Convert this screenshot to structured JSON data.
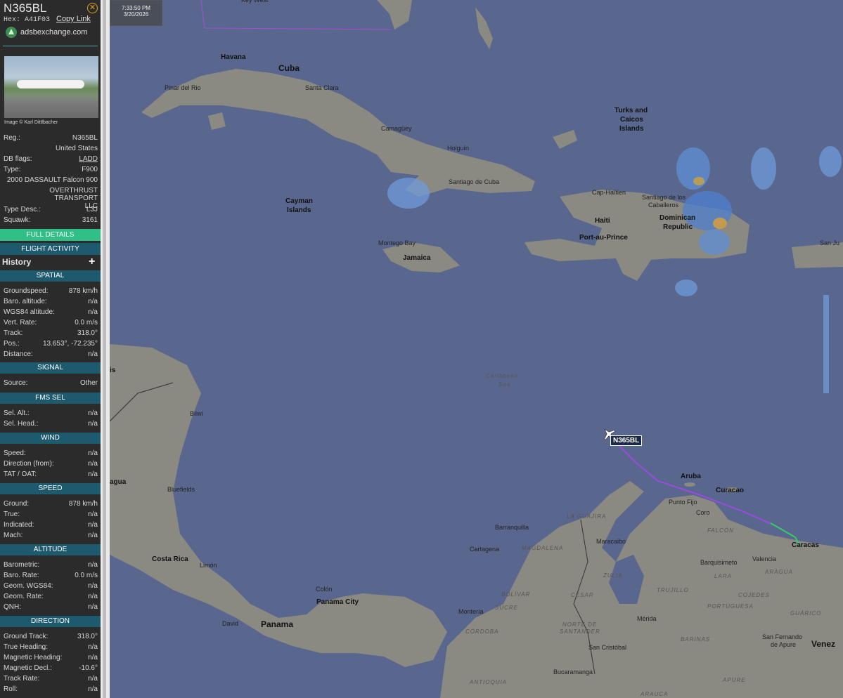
{
  "aircraft": {
    "callsign": "N365BL",
    "hex_label": "Hex:",
    "hex": "A41F03",
    "copy_link": "Copy Link",
    "source_site": "adsbexchange.com",
    "photo_credit": "Image © Karl Dittlbacher"
  },
  "info_rows": [
    {
      "k": "Reg.:",
      "v": "N365BL"
    },
    {
      "k": "",
      "v": "United States"
    },
    {
      "k": "DB flags:",
      "v": "LADD"
    },
    {
      "k": "Type:",
      "v": "F900"
    },
    {
      "k": "",
      "v": "2000 DASSAULT Falcon 900"
    },
    {
      "k": "",
      "v": "OVERTHRUST TRANSPORT LLC"
    },
    {
      "k": "Type Desc.:",
      "v": "L3J"
    },
    {
      "k": "Squawk:",
      "v": "3161"
    }
  ],
  "buttons": {
    "full_details": "FULL DETAILS",
    "flight_activity": "FLIGHT ACTIVITY"
  },
  "history": {
    "label": "History",
    "plus": "+"
  },
  "sections": {
    "spatial": {
      "title": "SPATIAL",
      "rows": [
        {
          "k": "Groundspeed:",
          "v": "878 km/h"
        },
        {
          "k": "Baro. altitude:",
          "v": "n/a"
        },
        {
          "k": "WGS84 altitude:",
          "v": "n/a"
        },
        {
          "k": "Vert. Rate:",
          "v": "0.0 m/s"
        },
        {
          "k": "Track:",
          "v": "318.0°"
        },
        {
          "k": "Pos.:",
          "v": "13.653°, -72.235°"
        },
        {
          "k": "Distance:",
          "v": "n/a"
        }
      ]
    },
    "signal": {
      "title": "SIGNAL",
      "rows": [
        {
          "k": "Source:",
          "v": "Other"
        }
      ]
    },
    "fms": {
      "title": "FMS SEL",
      "rows": [
        {
          "k": "Sel. Alt.:",
          "v": "n/a"
        },
        {
          "k": "Sel. Head.:",
          "v": "n/a"
        }
      ]
    },
    "wind": {
      "title": "WIND",
      "rows": [
        {
          "k": "Speed:",
          "v": "n/a"
        },
        {
          "k": "Direction (from):",
          "v": "n/a"
        },
        {
          "k": "TAT / OAT:",
          "v": "n/a"
        }
      ]
    },
    "speed": {
      "title": "SPEED",
      "rows": [
        {
          "k": "Ground:",
          "v": "878 km/h"
        },
        {
          "k": "True:",
          "v": "n/a"
        },
        {
          "k": "Indicated:",
          "v": "n/a"
        },
        {
          "k": "Mach:",
          "v": "n/a"
        }
      ]
    },
    "altitude": {
      "title": "ALTITUDE",
      "rows": [
        {
          "k": "Barometric:",
          "v": "n/a"
        },
        {
          "k": "Baro. Rate:",
          "v": "0.0 m/s"
        },
        {
          "k": "Geom. WGS84:",
          "v": "n/a"
        },
        {
          "k": "Geom. Rate:",
          "v": "n/a"
        },
        {
          "k": "QNH:",
          "v": "n/a"
        }
      ]
    },
    "direction": {
      "title": "DIRECTION",
      "rows": [
        {
          "k": "Ground Track:",
          "v": "318.0°"
        },
        {
          "k": "True Heading:",
          "v": "n/a"
        },
        {
          "k": "Magnetic Heading:",
          "v": "n/a"
        },
        {
          "k": "Magnetic Decl.:",
          "v": "-10.6°"
        },
        {
          "k": "Track Rate:",
          "v": "n/a"
        },
        {
          "k": "Roll:",
          "v": "n/a"
        }
      ]
    }
  },
  "map": {
    "time": "7:33:50 PM",
    "date": "3/20/2026",
    "callsign_label": "N365BL",
    "labels": {
      "key_west": "Key West",
      "havana": "Havana",
      "cuba": "Cuba",
      "pinar": "Pinar del Rio",
      "santa_clara": "Santa Clara",
      "camaguey": "Camagüey",
      "holguin": "Holguín",
      "santiago": "Santiago de Cuba",
      "turks": "Turks and",
      "caicos": "Caicos",
      "islands": "Islands",
      "cayman": "Cayman",
      "cayman2": "Islands",
      "cap_haitien": "Cap-Haïtien",
      "santiago_cab": "Santiago de los",
      "caballeros": "Caballeros",
      "haiti": "Haiti",
      "dominican": "Dominican",
      "republic": "Republic",
      "port_au_prince": "Port-au-Prince",
      "montego": "Montego Bay",
      "jamaica": "Jamaica",
      "san_juan": "San Ju",
      "caribbean": "Caribbean",
      "sea": "Sea",
      "bilwi": "Bilwi",
      "bluefields": "Bluefields",
      "agua": "agua",
      "aruba": "Aruba",
      "curacao": "Curacao",
      "punto_fijo": "Punto Fijo",
      "coro": "Coro",
      "falcon": "FALCÓN",
      "caracas": "Caracas",
      "barranquilla": "Barranquilla",
      "la_guajira": "LA GUAJIRA",
      "cartagena": "Cartagena",
      "magdalena": "MAGDALENA",
      "maracaibo": "Maracaibo",
      "valencia": "Valencia",
      "barquisimeto": "Barquisimeto",
      "aragua": "ARAGUA",
      "lara": "LARA",
      "zulia": "ZULIA",
      "trujillo": "TRUJILLO",
      "cojedes": "COJEDES",
      "portuguesa": "PORTUGUESA",
      "guarico": "GUÁRICO",
      "costa_rica": "Costa Rica",
      "limon": "Limón",
      "colon": "Colón",
      "panama_city": "Panama City",
      "panama": "Panama",
      "david": "David",
      "bolivar": "BOLÍVAR",
      "cesar": "CESAR",
      "sucre": "SUCRE",
      "monteria": "Montería",
      "cordoba": "CÓRDOBA",
      "norte": "NORTE DE",
      "santander": "SANTANDER",
      "merida": "Mérida",
      "barinas": "BARINAS",
      "san_fernando": "San Fernando",
      "de_apure": "de Apure",
      "venez": "Venez",
      "san_cristobal": "San Cristóbal",
      "bucaramanga": "Bucaramanga",
      "antioquia": "ANTIOQUIA",
      "arauca": "ARAUCA",
      "apure": "APURE",
      "is": "is"
    }
  }
}
